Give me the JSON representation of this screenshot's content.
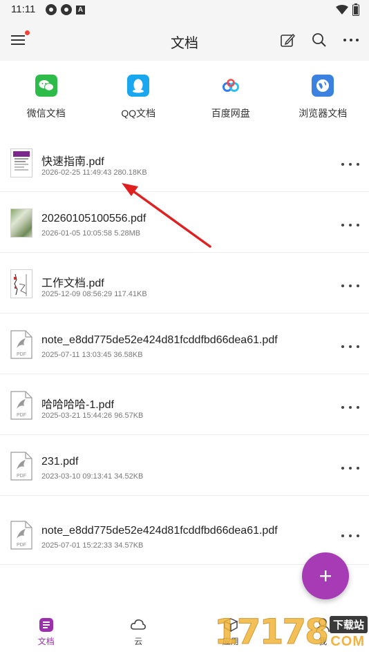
{
  "status_bar": {
    "time": "11:11",
    "left_icons": [
      "app-icon",
      "app-icon",
      "a-icon"
    ],
    "right_icons": [
      "wifi-icon",
      "battery-icon"
    ]
  },
  "header": {
    "title": "文档",
    "actions": [
      "edit-icon",
      "search-icon",
      "more-icon"
    ],
    "has_notification_dot": true
  },
  "sources": [
    {
      "label": "微信文档",
      "icon": "wechat-icon",
      "color": "#2dbb4a"
    },
    {
      "label": "QQ文档",
      "icon": "qq-icon",
      "color": "#1aa7f0"
    },
    {
      "label": "百度网盘",
      "icon": "baidu-netdisk-icon",
      "color": "#2f7df6"
    },
    {
      "label": "浏览器文档",
      "icon": "browser-icon",
      "color": "#3b82e0"
    }
  ],
  "files": [
    {
      "name": "快速指南.pdf",
      "meta": "2026-02-25 11:49:43 280.18KB",
      "thumb": "guide"
    },
    {
      "name": "20260105100556.pdf",
      "meta": "2026-01-05 10:05:58 5.28MB",
      "thumb": "photo"
    },
    {
      "name": "工作文档.pdf",
      "meta": "2025-12-09 08:56:29 117.41KB",
      "thumb": "sketch"
    },
    {
      "name": "note_e8dd775de52e424d81fcddfbd66dea61.pdf",
      "meta": "2025-07-11 13:03:45 36.58KB",
      "thumb": "generic"
    },
    {
      "name": "哈哈哈哈-1.pdf",
      "meta": "2025-03-21 15:44:26 96.57KB",
      "thumb": "generic"
    },
    {
      "name": "231.pdf",
      "meta": "2023-03-10 09:13:41 34.52KB",
      "thumb": "generic"
    },
    {
      "name": "note_e8dd775de52e424d81fcddfbd66dea61.pdf",
      "meta": "2025-07-01 15:22:33 34.57KB",
      "thumb": "generic"
    }
  ],
  "pdf_badge": "PDF",
  "fab": {
    "icon": "plus-icon",
    "color": "#a63bb5"
  },
  "bottom_nav": [
    {
      "label": "文档",
      "icon": "document-icon",
      "active": true
    },
    {
      "label": "云",
      "icon": "cloud-icon",
      "active": false
    },
    {
      "label": "应用",
      "icon": "apps-icon",
      "active": false
    },
    {
      "label": "我",
      "icon": "user-icon",
      "active": false
    }
  ],
  "accent_color": "#9c2fae",
  "annotation": {
    "type": "red-arrow",
    "color": "#e02020"
  },
  "watermark": {
    "digits": "17178",
    "site": "下载站",
    "domain": "COM"
  }
}
